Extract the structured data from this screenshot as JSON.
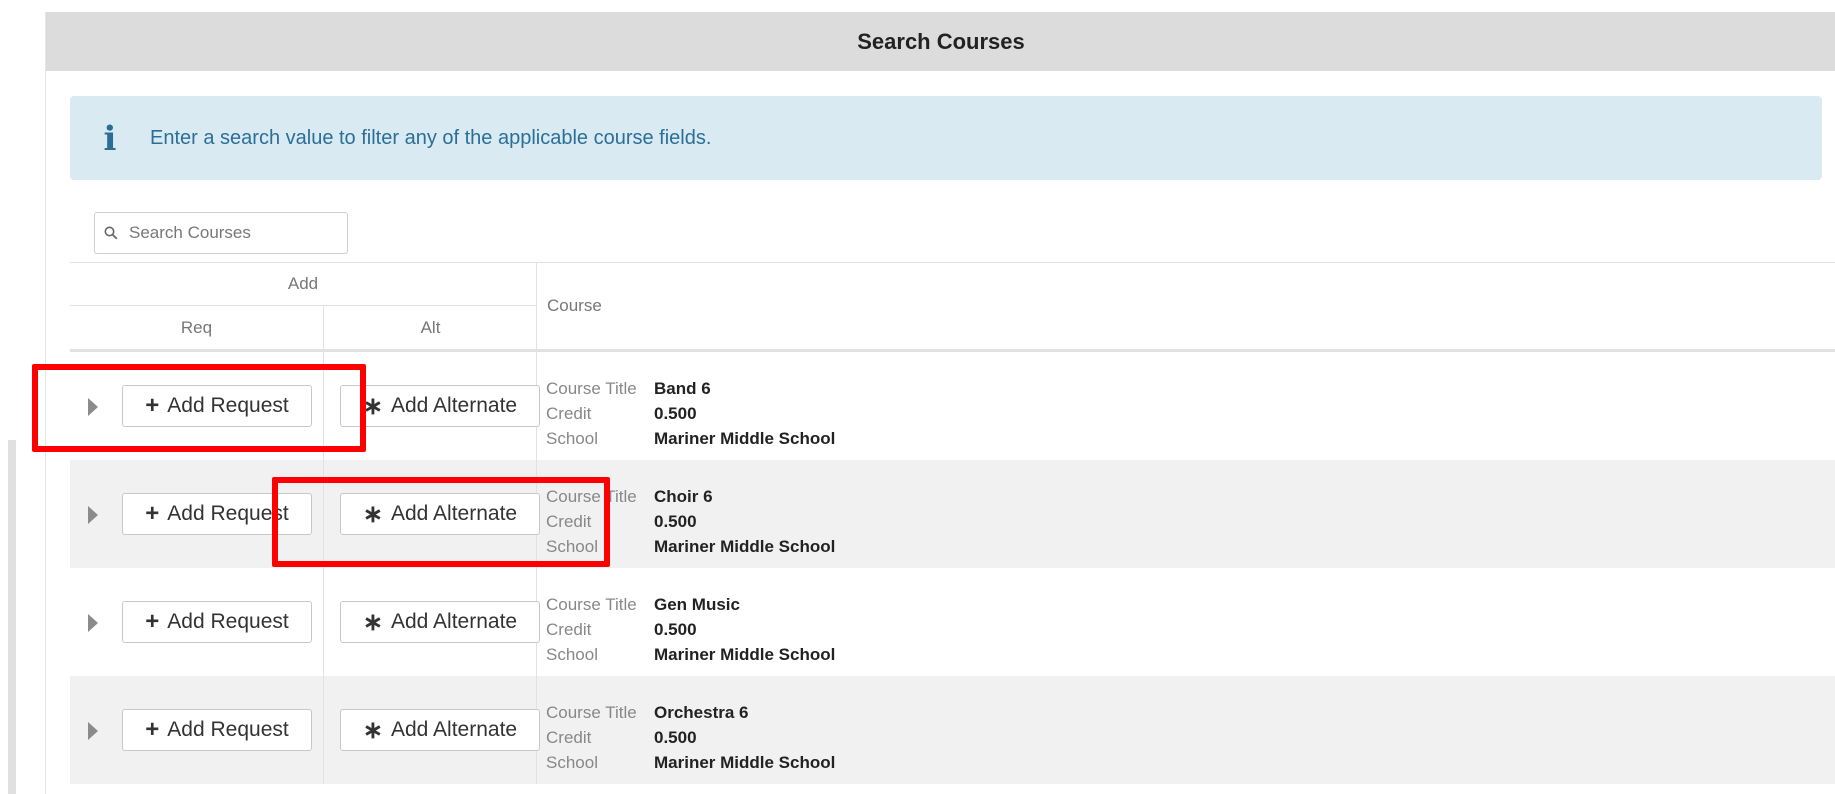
{
  "panel": {
    "title": "Search Courses"
  },
  "info": {
    "icon": "info-icon",
    "message": "Enter a search value to filter any of the applicable course fields."
  },
  "search": {
    "icon": "search-icon",
    "placeholder": "Search Courses",
    "value": ""
  },
  "table": {
    "headers": {
      "add": "Add",
      "req": "Req",
      "alt": "Alt",
      "course": "Course"
    },
    "labels": {
      "course_title": "Course Title",
      "credit": "Credit",
      "school": "School"
    },
    "buttons": {
      "add_request": "Add Request",
      "add_alternate": "Add Alternate",
      "plus_glyph": "+",
      "asterisk_glyph": "∗"
    },
    "rows": [
      {
        "course_title": "Band 6",
        "credit": "0.500",
        "school": "Mariner Middle School"
      },
      {
        "course_title": "Choir 6",
        "credit": "0.500",
        "school": "Mariner Middle School"
      },
      {
        "course_title": "Gen Music",
        "credit": "0.500",
        "school": "Mariner Middle School"
      },
      {
        "course_title": "Orchestra 6",
        "credit": "0.500",
        "school": "Mariner Middle School"
      }
    ]
  },
  "colors": {
    "header_bg": "#dcdcdc",
    "info_bg": "#d9eaf3",
    "info_text": "#2b6f97",
    "highlight": "#ff0000",
    "row_shade": "#f1f1f1"
  }
}
